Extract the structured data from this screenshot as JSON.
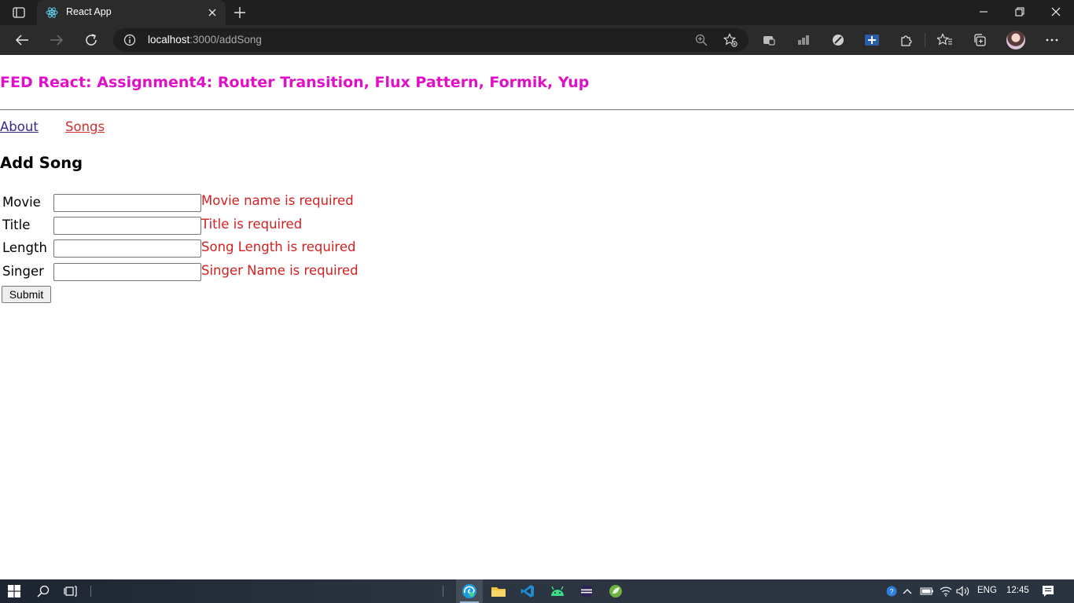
{
  "browser": {
    "tab": {
      "title": "React App"
    },
    "address": {
      "host": "localhost",
      "path": ":3000/addSong"
    }
  },
  "page": {
    "title": "FED React: Assignment4: Router Transition, Flux Pattern, Formik, Yup",
    "nav": [
      {
        "label": "About"
      },
      {
        "label": "Songs"
      }
    ],
    "section_title": "Add Song",
    "form": {
      "fields": [
        {
          "label": "Movie",
          "value": "",
          "error": "Movie name is required"
        },
        {
          "label": "Title",
          "value": "",
          "error": "Title is required"
        },
        {
          "label": "Length",
          "value": "",
          "error": "Song Length is required"
        },
        {
          "label": "Singer",
          "value": "",
          "error": "Singer Name is required"
        }
      ],
      "submit_label": "Submit"
    }
  },
  "taskbar": {
    "language": "ENG",
    "time": "12:45"
  },
  "colors": {
    "title": "#e010c8",
    "error": "#d32020",
    "nav_visited": "#3b2a8a",
    "nav_link": "#d32f2f"
  }
}
